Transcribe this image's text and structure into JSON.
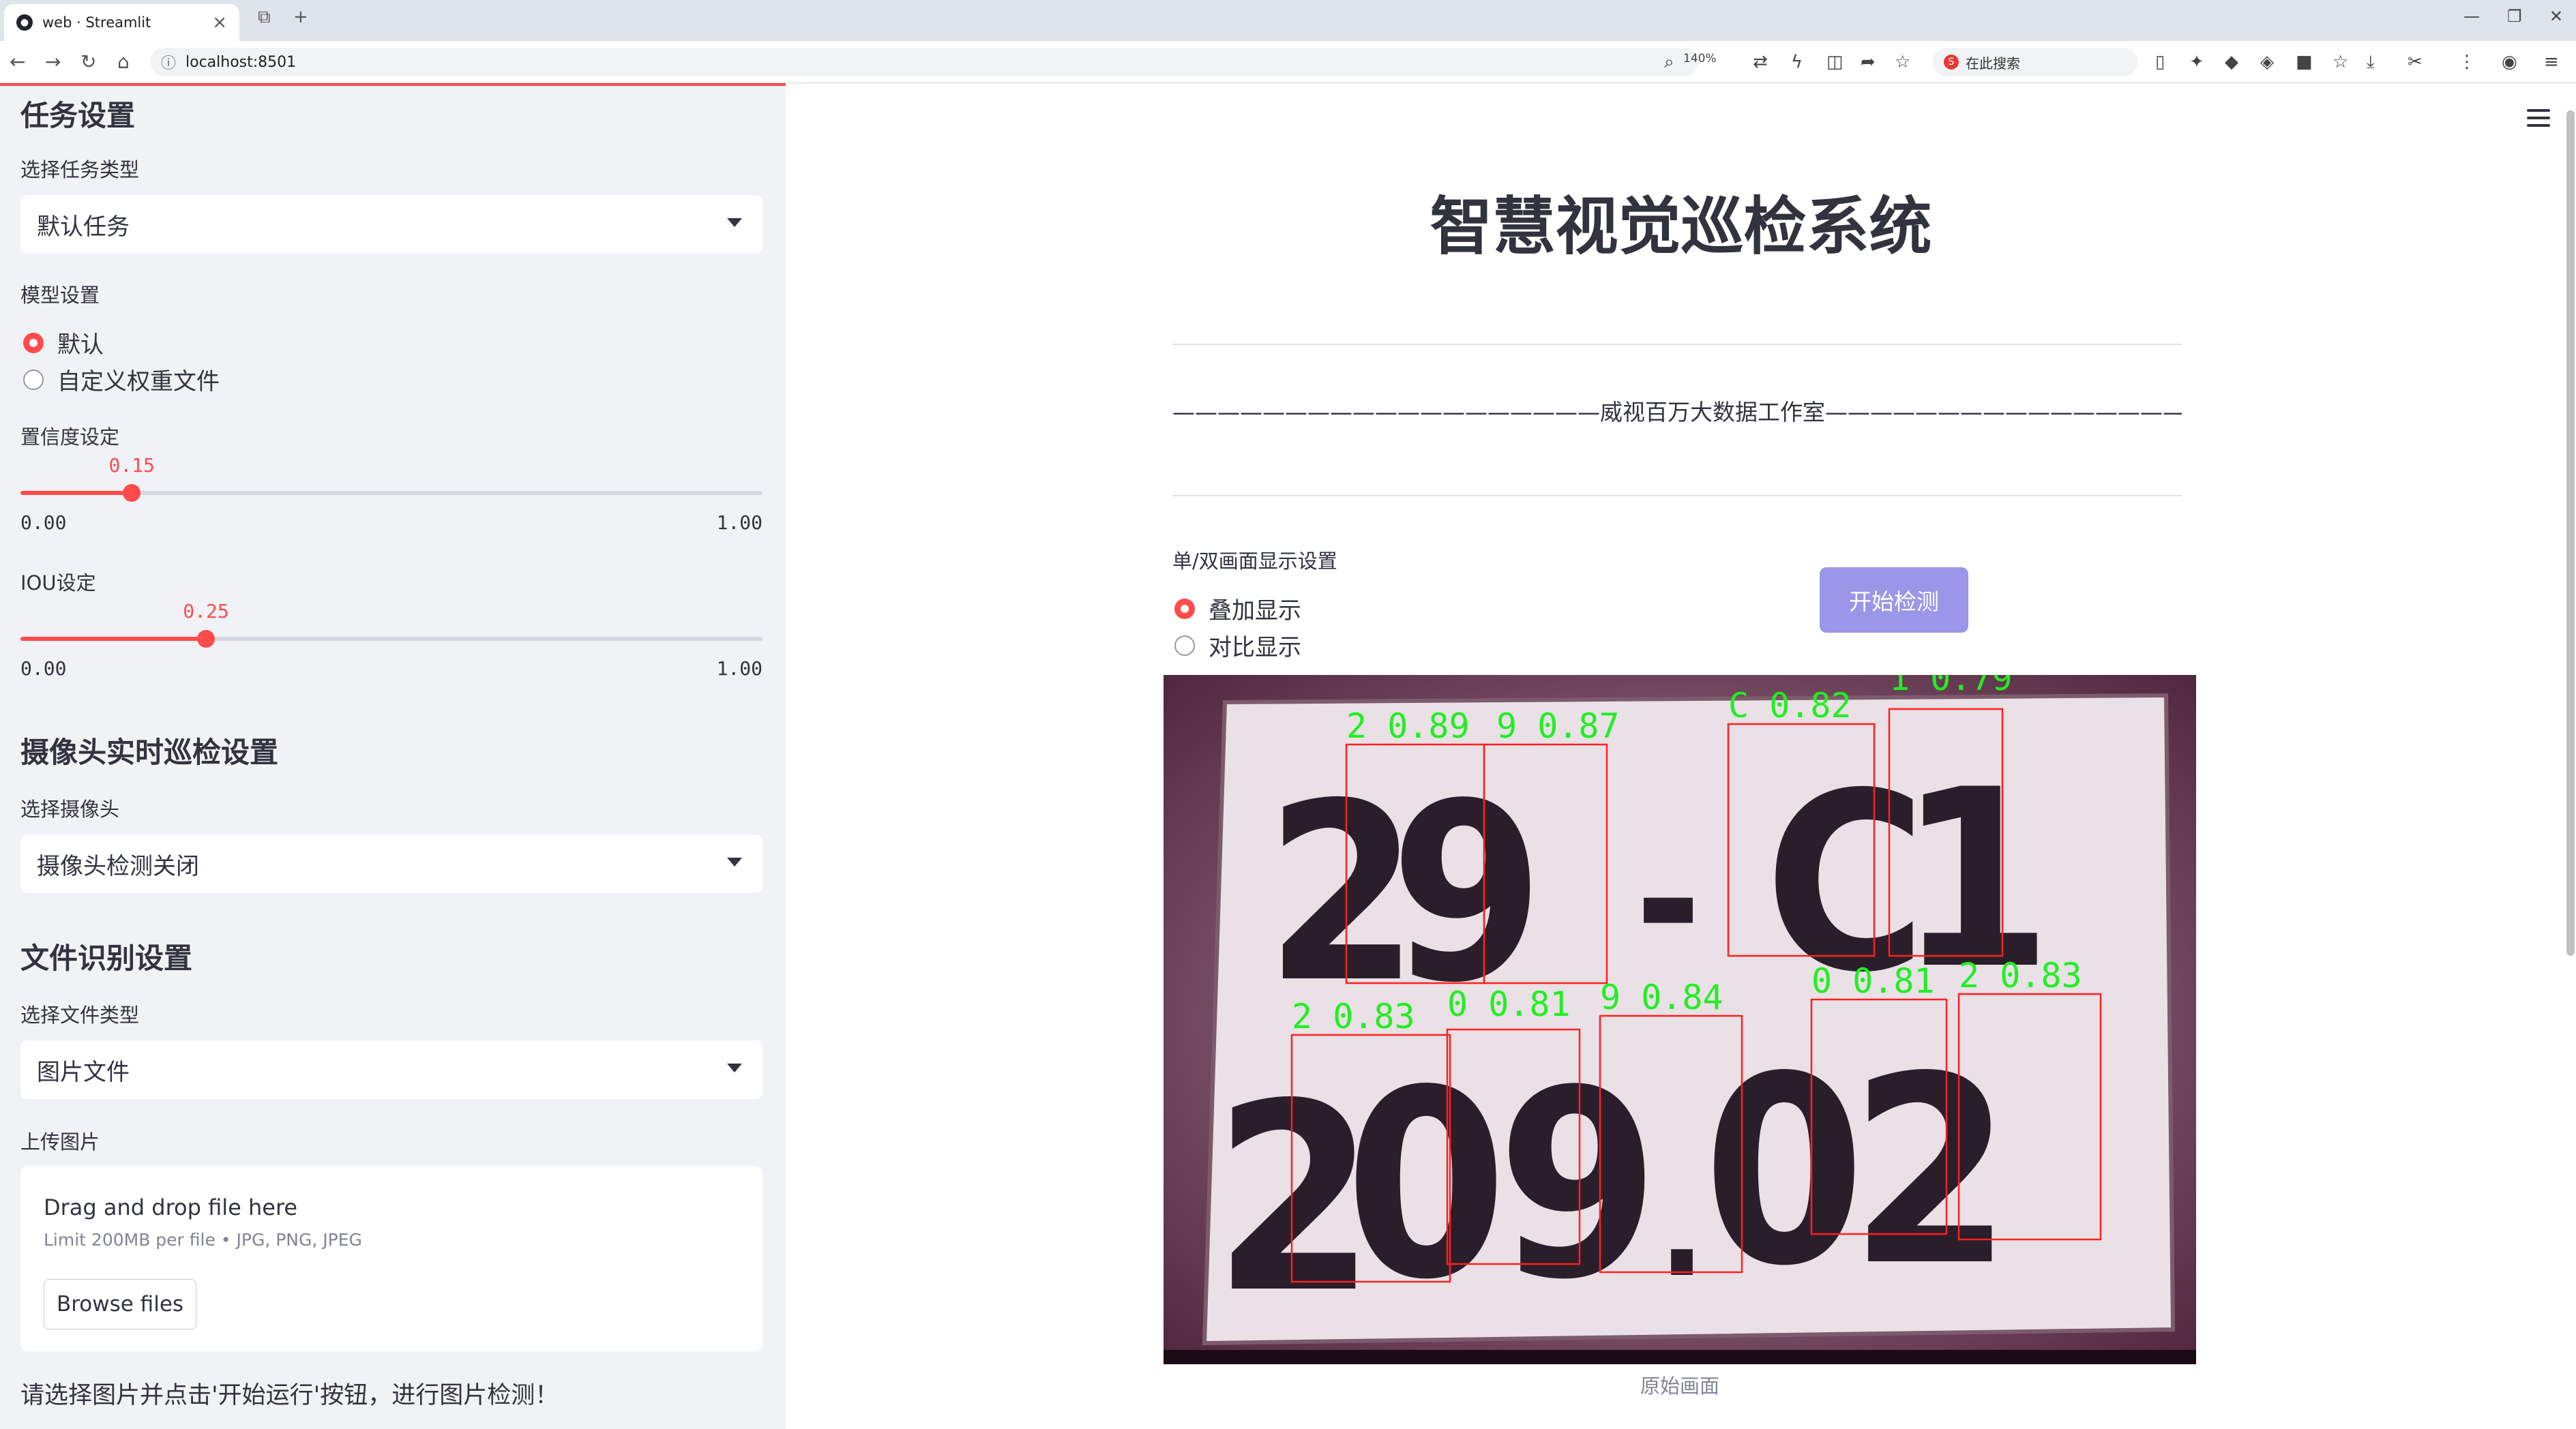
{
  "browser": {
    "tab_title": "web · Streamlit",
    "url": "localhost:8501",
    "zoom": "140%",
    "search_placeholder": "在此搜索"
  },
  "sidebar": {
    "task_section": {
      "heading": "任务设置",
      "task_type_label": "选择任务类型",
      "task_type_value": "默认任务"
    },
    "model_section": {
      "label": "模型设置",
      "options": [
        "默认",
        "自定义权重文件"
      ],
      "selected": 0
    },
    "confidence": {
      "label": "置信度设定",
      "value": "0.15",
      "value_num": 0.15,
      "min": "0.00",
      "max": "1.00"
    },
    "iou": {
      "label": "IOU设定",
      "value": "0.25",
      "value_num": 0.25,
      "min": "0.00",
      "max": "1.00"
    },
    "camera_section": {
      "heading": "摄像头实时巡检设置",
      "label": "选择摄像头",
      "value": "摄像头检测关闭"
    },
    "file_section": {
      "heading": "文件识别设置",
      "type_label": "选择文件类型",
      "type_value": "图片文件",
      "upload_label": "上传图片",
      "drop_text": "Drag and drop file here",
      "limit_text": "Limit 200MB per file • JPG, PNG, JPEG",
      "browse_label": "Browse files"
    },
    "note": "请选择图片并点击'开始运行'按钮，进行图片检测！"
  },
  "main": {
    "title": "智慧视觉巡检系统",
    "subtitle": "———————————————————威视百万大数据工作室————————————————————",
    "display_label": "单/双画面显示设置",
    "display_options": [
      "叠加显示",
      "对比显示"
    ],
    "display_selected": 0,
    "start_button": "开始检测",
    "caption": "原始画面",
    "detections": [
      {
        "label": "2  0.89"
      },
      {
        "label": "9  0.87"
      },
      {
        "label": "C  0.82"
      },
      {
        "label": "1  0.79"
      },
      {
        "label": "2  0.83"
      },
      {
        "label": "0  0.81"
      },
      {
        "label": "9  0.84"
      },
      {
        "label": "0  0.81"
      },
      {
        "label": "2  0.83"
      }
    ]
  },
  "colors": {
    "accent": "#ff4b4b",
    "sidebar_bg": "#f0f2f6",
    "button_bg": "#9a96e8",
    "box_color": "#ff2020",
    "label_color": "#22ee22"
  }
}
